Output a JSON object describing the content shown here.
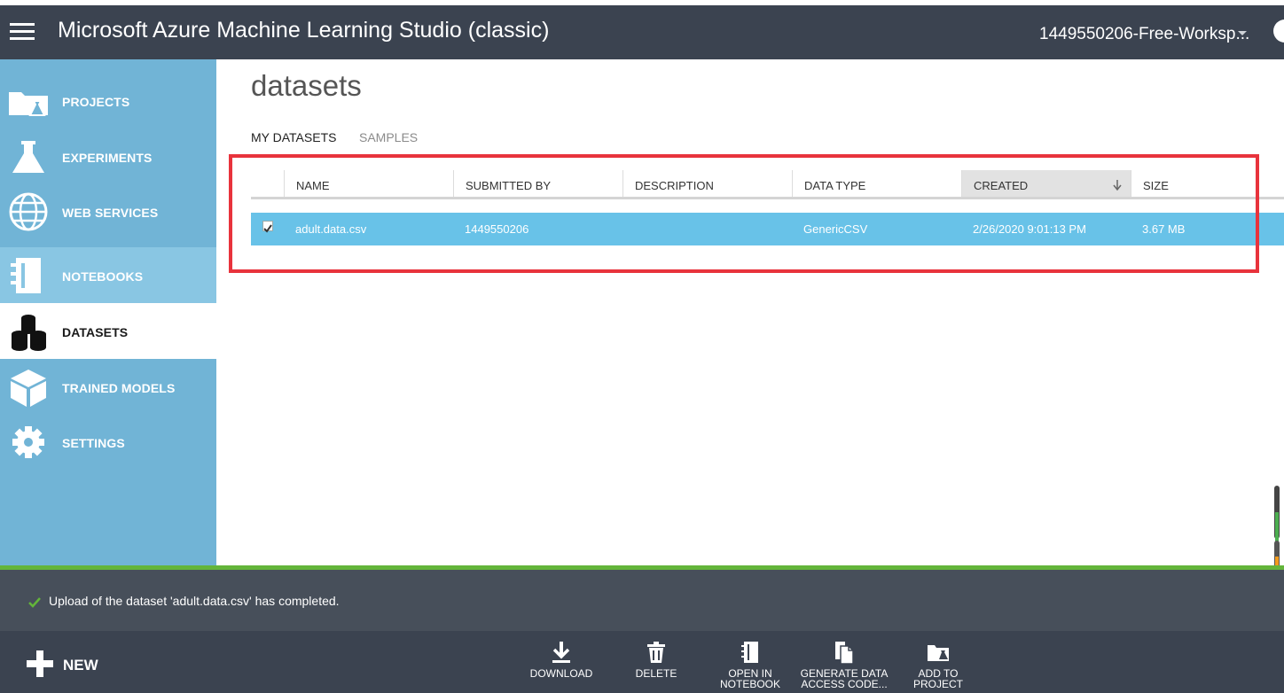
{
  "header": {
    "title": "Microsoft Azure Machine Learning Studio (classic)",
    "workspace": "1449550206-Free-Worksp..."
  },
  "sidebar": {
    "items": [
      {
        "label": "PROJECTS",
        "icon": "projects-folder-icon"
      },
      {
        "label": "EXPERIMENTS",
        "icon": "flask-icon"
      },
      {
        "label": "WEB SERVICES",
        "icon": "globe-icon"
      },
      {
        "label": "NOTEBOOKS",
        "icon": "notebook-icon"
      },
      {
        "label": "DATASETS",
        "icon": "database-icon"
      },
      {
        "label": "TRAINED MODELS",
        "icon": "cube-icon"
      },
      {
        "label": "SETTINGS",
        "icon": "gear-icon"
      }
    ],
    "active": "DATASETS"
  },
  "main": {
    "title": "datasets",
    "tabs": [
      {
        "label": "MY DATASETS",
        "active": true
      },
      {
        "label": "SAMPLES",
        "active": false
      }
    ]
  },
  "table": {
    "columns": [
      "NAME",
      "SUBMITTED BY",
      "DESCRIPTION",
      "DATA TYPE",
      "CREATED",
      "SIZE"
    ],
    "sorted_column": "CREATED",
    "rows": [
      {
        "checked": true,
        "name": "adult.data.csv",
        "submitted_by": "1449550206",
        "description": "",
        "data_type": "GenericCSV",
        "created": "2/26/2020 9:01:13 PM",
        "size": "3.67 MB"
      }
    ]
  },
  "status": {
    "message": "Upload of the dataset 'adult.data.csv' has completed."
  },
  "commands": {
    "new_label": "NEW",
    "download": "DOWNLOAD",
    "delete": "DELETE",
    "open_line1": "OPEN IN",
    "open_line2": "NOTEBOOK",
    "generate_line1": "GENERATE DATA",
    "generate_line2": "ACCESS CODE...",
    "add_to_project": "ADD TO PROJECT"
  },
  "colors": {
    "topbar": "#3b4350",
    "sidebar": "#71b4d6",
    "selected_row": "#68c2e8",
    "highlight": "#e8333c",
    "success": "#63b53a"
  }
}
